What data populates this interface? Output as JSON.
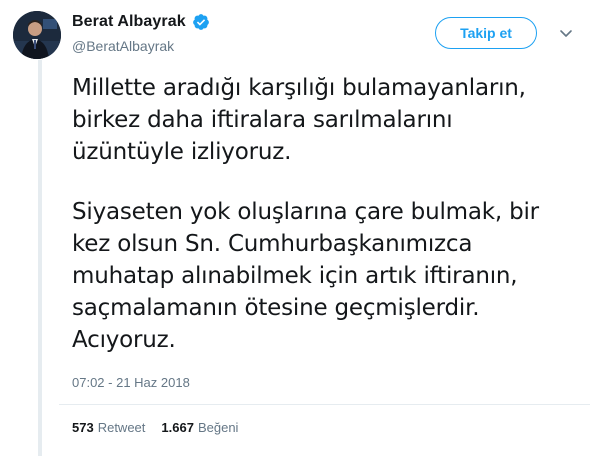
{
  "author": {
    "display_name": "Berat Albayrak",
    "handle": "@BeratAlbayrak",
    "verified_icon": "verified-badge-icon",
    "avatar_icon": "profile-photo"
  },
  "actions": {
    "follow_label": "Takip et",
    "more_icon": "chevron-down-icon"
  },
  "tweet": {
    "paragraph_1": [
      "Millette aradığı karşılığı bulamayanların,",
      "birkez daha iftiralara sarılmalarını",
      "üzüntüyle izliyoruz."
    ],
    "paragraph_2": [
      "Siyaseten yok oluşlarına çare bulmak, bir",
      "kez olsun Sn. Cumhurbaşkanımızca",
      "muhatap alınabilmek için artık iftiranın,",
      "saçmalamanın ötesine geçmişlerdir.",
      "Acıyoruz."
    ],
    "timestamp": "07:02 - 21 Haz 2018"
  },
  "stats": {
    "retweet_count": "573",
    "retweet_label": "Retweet",
    "like_count": "1.667",
    "like_label": "Beğeni"
  },
  "colors": {
    "accent": "#1da1f2",
    "text": "#14171a",
    "muted": "#657786",
    "divider": "#e6ecf0"
  }
}
